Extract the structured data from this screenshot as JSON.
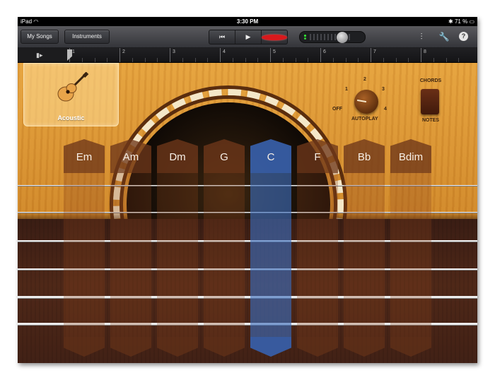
{
  "status_bar": {
    "device": "iPad",
    "time": "3:30 PM",
    "battery": "71 %"
  },
  "toolbar": {
    "my_songs_label": "My Songs",
    "instruments_label": "Instruments",
    "transport": {
      "rewind_icon": "⏮",
      "play_icon": "▶"
    },
    "help_label": "?"
  },
  "ruler": {
    "bars": [
      "1",
      "2",
      "3",
      "4",
      "5",
      "6",
      "7",
      "8"
    ]
  },
  "instrument": {
    "name": "Acoustic"
  },
  "autoplay": {
    "label": "AUTOPLAY",
    "positions": [
      "OFF",
      "1",
      "2",
      "3",
      "4"
    ]
  },
  "chords_switch": {
    "top_label": "CHORDS",
    "bottom_label": "NOTES"
  },
  "chords": [
    {
      "name": "Em",
      "active": false
    },
    {
      "name": "Am",
      "active": false
    },
    {
      "name": "Dm",
      "active": false
    },
    {
      "name": "G",
      "active": false
    },
    {
      "name": "C",
      "active": true
    },
    {
      "name": "F",
      "active": false
    },
    {
      "name": "Bb",
      "active": false
    },
    {
      "name": "Bdim",
      "active": false
    }
  ],
  "colors": {
    "accent_active": "#3c6ebe",
    "wood": "#d98f30",
    "neck": "#45231a",
    "record": "#d8191c"
  }
}
